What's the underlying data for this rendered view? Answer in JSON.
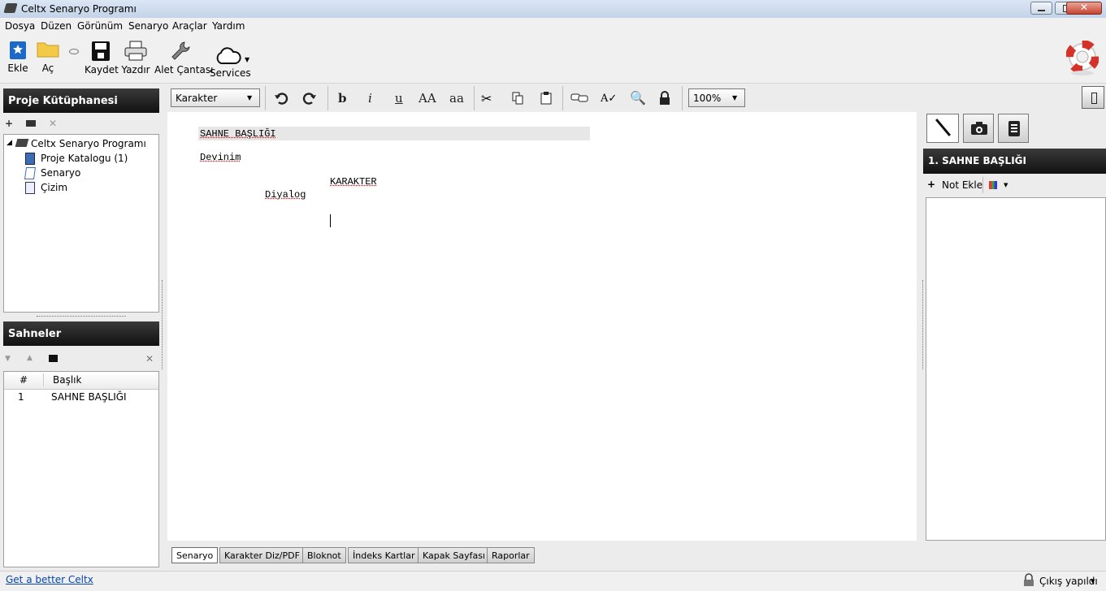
{
  "window": {
    "title": "Celtx Senaryo Programı"
  },
  "menubar": {
    "items": [
      "Dosya",
      "Düzen",
      "Görünüm",
      "Senaryo",
      "Araçlar",
      "Yardım"
    ]
  },
  "toolbar": {
    "add_label": "Ekle",
    "open_label": "Aç",
    "save_label": "Kaydet",
    "print_label": "Yazdır",
    "toolbox_label": "Alet Çantası",
    "services_label": "Services"
  },
  "library": {
    "title": "Proje Kütüphanesi",
    "root": "Celtx Senaryo Programı",
    "items": [
      "Proje Katalogu (1)",
      "Senaryo",
      "Çizim"
    ]
  },
  "scenes": {
    "title": "Sahneler",
    "col_num": "#",
    "col_title": "Başlık",
    "rows": [
      {
        "num": "1",
        "title": "SAHNE BAŞLIĞI"
      }
    ]
  },
  "editor": {
    "style_select": "Karakter",
    "zoom": "100%",
    "bold": "b",
    "italic": "i",
    "underline": "u",
    "upper": "AA",
    "lower": "aa",
    "scene_heading": "SAHNE BAŞLIĞI",
    "action": "Devinim",
    "character": "KARAKTER",
    "dialog": "Diyalog"
  },
  "tabs": [
    "Senaryo",
    "Karakter Diz/PDF",
    "Bloknot",
    "İndeks Kartlar",
    "Kapak Sayfası",
    "Raporlar"
  ],
  "rightpanel": {
    "heading": "1. SAHNE BAŞLIĞI",
    "add_note": "Not Ekle"
  },
  "status": {
    "link": "Get a better Celtx",
    "login": "Çıkış yapıldı"
  }
}
